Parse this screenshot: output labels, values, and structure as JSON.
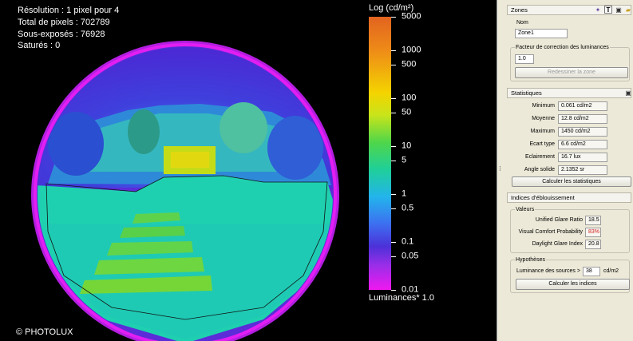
{
  "viewer": {
    "info": {
      "resolution": "Résolution : 1 pixel pour 4",
      "total_pixels": "Total de pixels : 702789",
      "underexposed": "Sous-exposés : 76928",
      "saturated": "Saturés : 0"
    },
    "copyright": "© PHOTOLUX",
    "scale": {
      "title": "Log (cd/m²)",
      "footer": "Luminances* 1.0",
      "ticks": [
        {
          "label": "5000",
          "value": 5000
        },
        {
          "label": "1000",
          "value": 1000
        },
        {
          "label": "500",
          "value": 500
        },
        {
          "label": "100",
          "value": 100
        },
        {
          "label": "50",
          "value": 50
        },
        {
          "label": "10",
          "value": 10
        },
        {
          "label": "5",
          "value": 5
        },
        {
          "label": "1",
          "value": 1
        },
        {
          "label": "0.5",
          "value": 0.5
        },
        {
          "label": "0.1",
          "value": 0.1
        },
        {
          "label": "0.05",
          "value": 0.05
        },
        {
          "label": "0.01",
          "value": 0.01
        }
      ],
      "range": [
        0.01,
        5000
      ],
      "log_scale": true
    }
  },
  "panel": {
    "zones": {
      "header": "Zones",
      "name_label": "Nom",
      "name_value": "Zone1",
      "correction_label": "Facteur de correction des luminances",
      "correction_value": "1.0",
      "redraw_button": "Redessiner la zone",
      "toolbar_icons": [
        "wand-icon",
        "text-tool-icon",
        "save-icon",
        "folder-icon"
      ]
    },
    "statistics": {
      "header": "Statistiques",
      "rows": [
        {
          "label": "Minimum",
          "value": "0.061 cd/m2"
        },
        {
          "label": "Moyenne",
          "value": "12.8 cd/m2"
        },
        {
          "label": "Maximum",
          "value": "1450 cd/m2"
        },
        {
          "label": "Ecart type",
          "value": "6.6 cd/m2"
        },
        {
          "label": "Eclairement",
          "value": "16.7 lux"
        },
        {
          "label": "Angle solide",
          "value": "2.1352 sr"
        }
      ],
      "compute_button": "Calculer les statistiques"
    },
    "glare": {
      "header": "Indices d'éblouissement",
      "values_label": "Valeurs",
      "rows": [
        {
          "label": "Unified Glare Ratio",
          "value": "18.5",
          "highlight": false
        },
        {
          "label": "Visual Comfort Probability",
          "value": "83%",
          "highlight": true
        },
        {
          "label": "Daylight Glare Index",
          "value": "20.8",
          "highlight": false
        }
      ],
      "hypotheses_label": "Hypothèses",
      "sources_label": "Luminance des sources >",
      "sources_value": "38",
      "sources_unit": "cd/m2",
      "compute_button": "Calculer les indices"
    }
  },
  "colors": {
    "highlight_red": "#d42020",
    "panel_bg": "#ece9d8"
  }
}
